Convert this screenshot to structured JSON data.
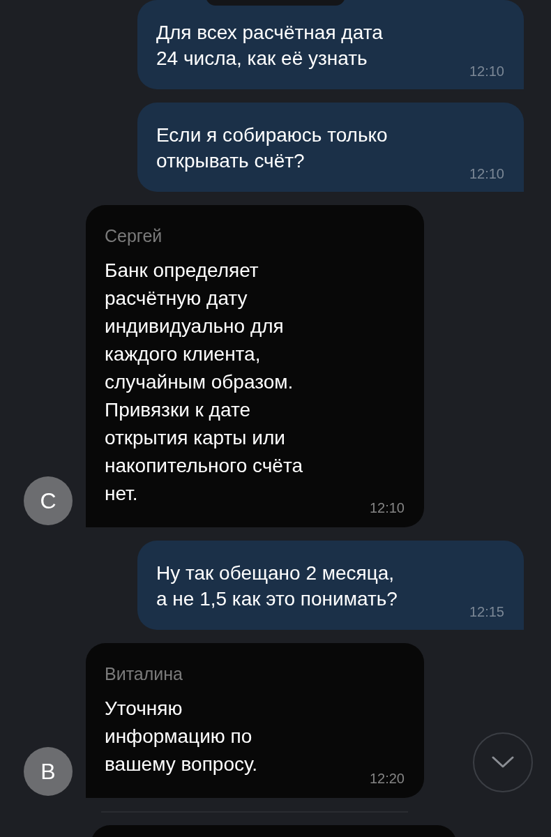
{
  "messages": [
    {
      "kind": "outgoing",
      "text": "Для всех расчётная дата\n24 числа, как её узнать",
      "time": "12:10"
    },
    {
      "kind": "outgoing",
      "text": "Если я собираюсь только\nоткрывать счёт?",
      "time": "12:10"
    },
    {
      "kind": "incoming",
      "sender": "Сергей",
      "avatar": "С",
      "text": "Банк определяет\nрасчётную дату\nиндивидуально для\nкаждого клиента,\nслучайным образом.\nПривязки к дате\nоткрытия карты или\nнакопительного счёта\nнет.",
      "time": "12:10"
    },
    {
      "kind": "outgoing",
      "text": "Ну так обещано 2 месяца,\nа не 1,5 как это понимать?",
      "time": "12:15"
    },
    {
      "kind": "incoming",
      "sender": "Виталина",
      "avatar": "В",
      "text": "Уточняю\nинформацию по\nвашему вопросу.",
      "time": "12:20"
    }
  ]
}
